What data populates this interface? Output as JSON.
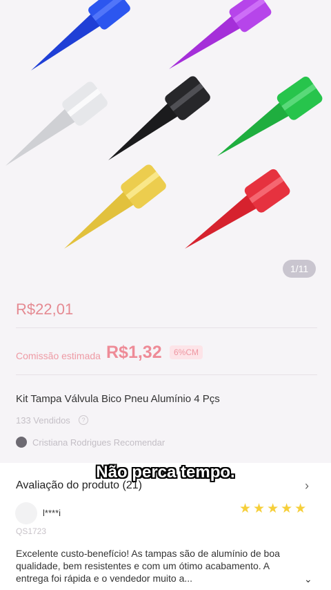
{
  "gallery": {
    "page_indicator": "1/11"
  },
  "product": {
    "price": "R$22,01",
    "commission_label": "Comissão estimada",
    "commission_value": "R$1,32",
    "commission_badge": "6%CM",
    "title": "Kit Tampa Válvula Bico Pneu Alumínio 4 Pçs",
    "sold": "133 Vendidos",
    "recommender": "Cristiana Rodrigues Recomendar"
  },
  "subtitle": "Não perca tempo.",
  "reviews": {
    "title": "Avaliação do produto (21)",
    "user": "l****i",
    "stars": "★★★★★",
    "variant": "QS1723",
    "text": "Excelente custo-benefício! As tampas são de alumínio de boa qualidade, bem resistentes e com um ótimo acabamento. A entrega foi rápida e o vendedor muito a..."
  },
  "colors": {
    "blue": "#1f3fd6",
    "purple": "#a52fd9",
    "silver": "#d9dadd",
    "black": "#1b1b1d",
    "green": "#1fae3f",
    "gold": "#e2c13d",
    "red": "#d6222e"
  }
}
